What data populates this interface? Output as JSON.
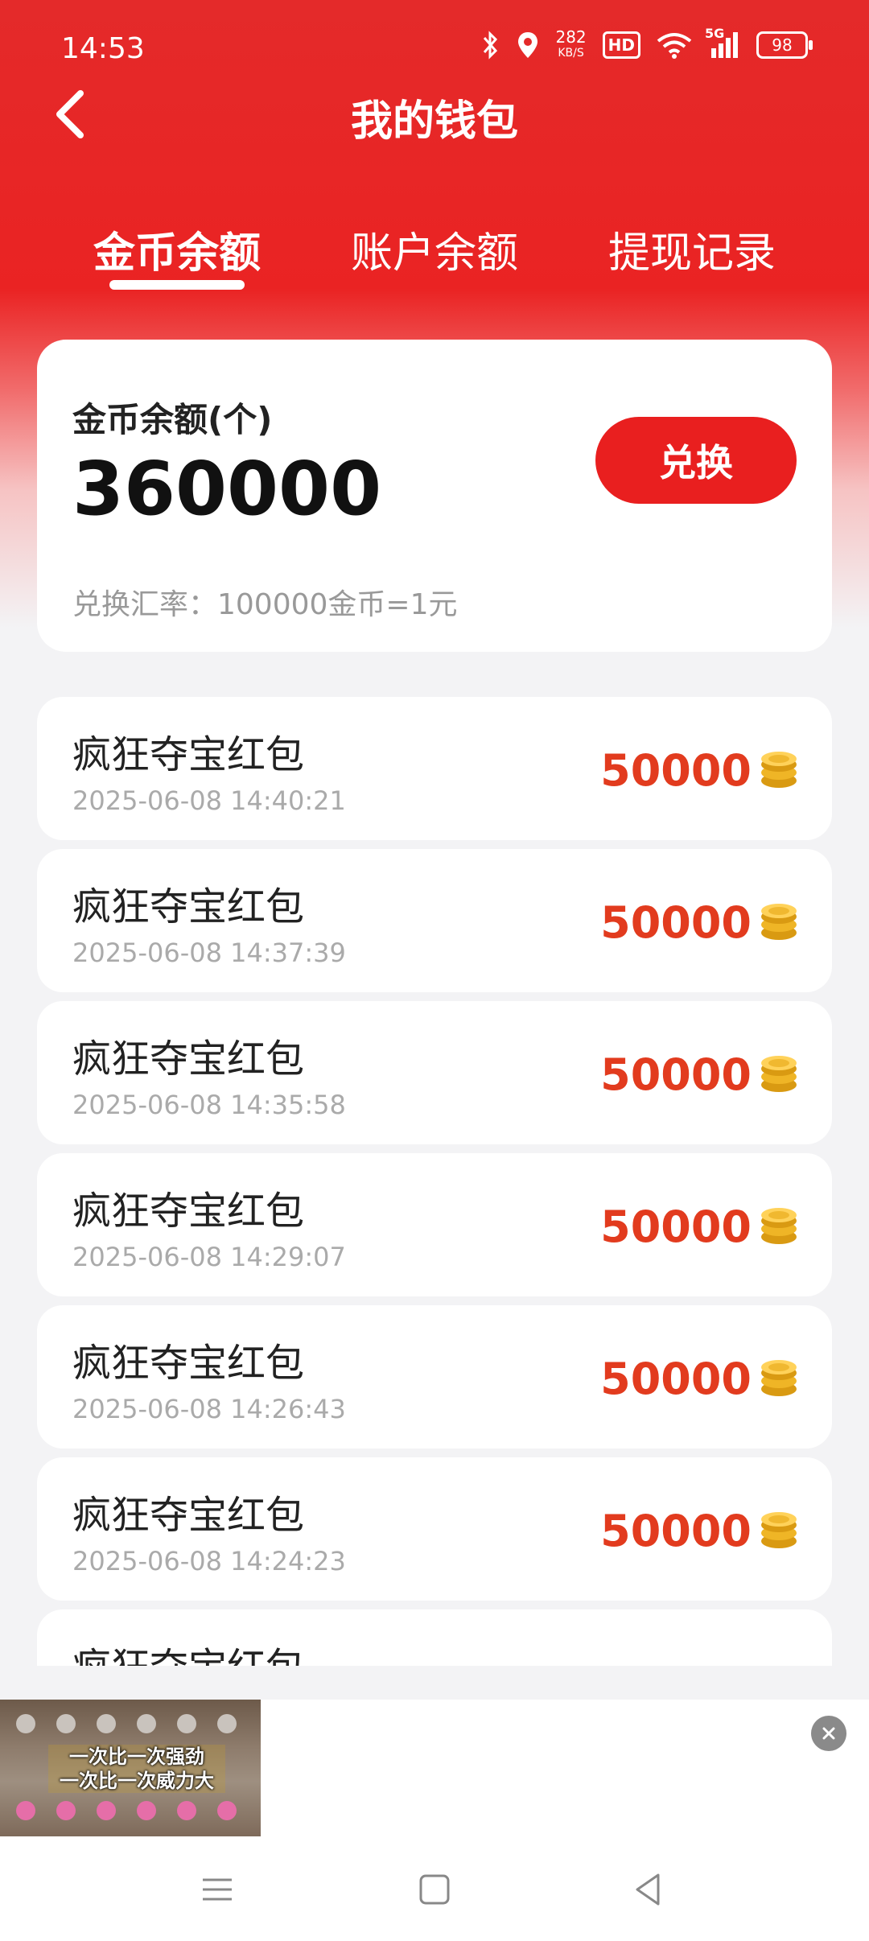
{
  "status_bar": {
    "time": "14:53",
    "speed_value": "282",
    "speed_unit": "KB/S",
    "hd": "HD",
    "network": "5G",
    "battery": "98"
  },
  "header": {
    "title": "我的钱包",
    "back_icon": "chevron-left-icon"
  },
  "tabs": [
    {
      "label": "金币余额",
      "active": true
    },
    {
      "label": "账户余额",
      "active": false
    },
    {
      "label": "提现记录",
      "active": false
    }
  ],
  "balance": {
    "label": "金币余额(个)",
    "amount": "360000",
    "exchange_label": "兑换",
    "rate_text": "兑换汇率：100000金币=1元"
  },
  "records": [
    {
      "name": "疯狂夺宝红包",
      "date": "2025-06-08 14:40:21",
      "amount": "50000"
    },
    {
      "name": "疯狂夺宝红包",
      "date": "2025-06-08 14:37:39",
      "amount": "50000"
    },
    {
      "name": "疯狂夺宝红包",
      "date": "2025-06-08 14:35:58",
      "amount": "50000"
    },
    {
      "name": "疯狂夺宝红包",
      "date": "2025-06-08 14:29:07",
      "amount": "50000"
    },
    {
      "name": "疯狂夺宝红包",
      "date": "2025-06-08 14:26:43",
      "amount": "50000"
    },
    {
      "name": "疯狂夺宝红包",
      "date": "2025-06-08 14:24:23",
      "amount": "50000"
    },
    {
      "name": "疯狂夺宝红包",
      "date": "",
      "amount": ""
    }
  ],
  "ad": {
    "caption_line1": "一次比一次强劲",
    "caption_line2": "一次比一次威力大",
    "close_icon": "close-icon"
  },
  "colors": {
    "brand_red": "#e91f1f",
    "amount_red": "#e23b1e"
  }
}
